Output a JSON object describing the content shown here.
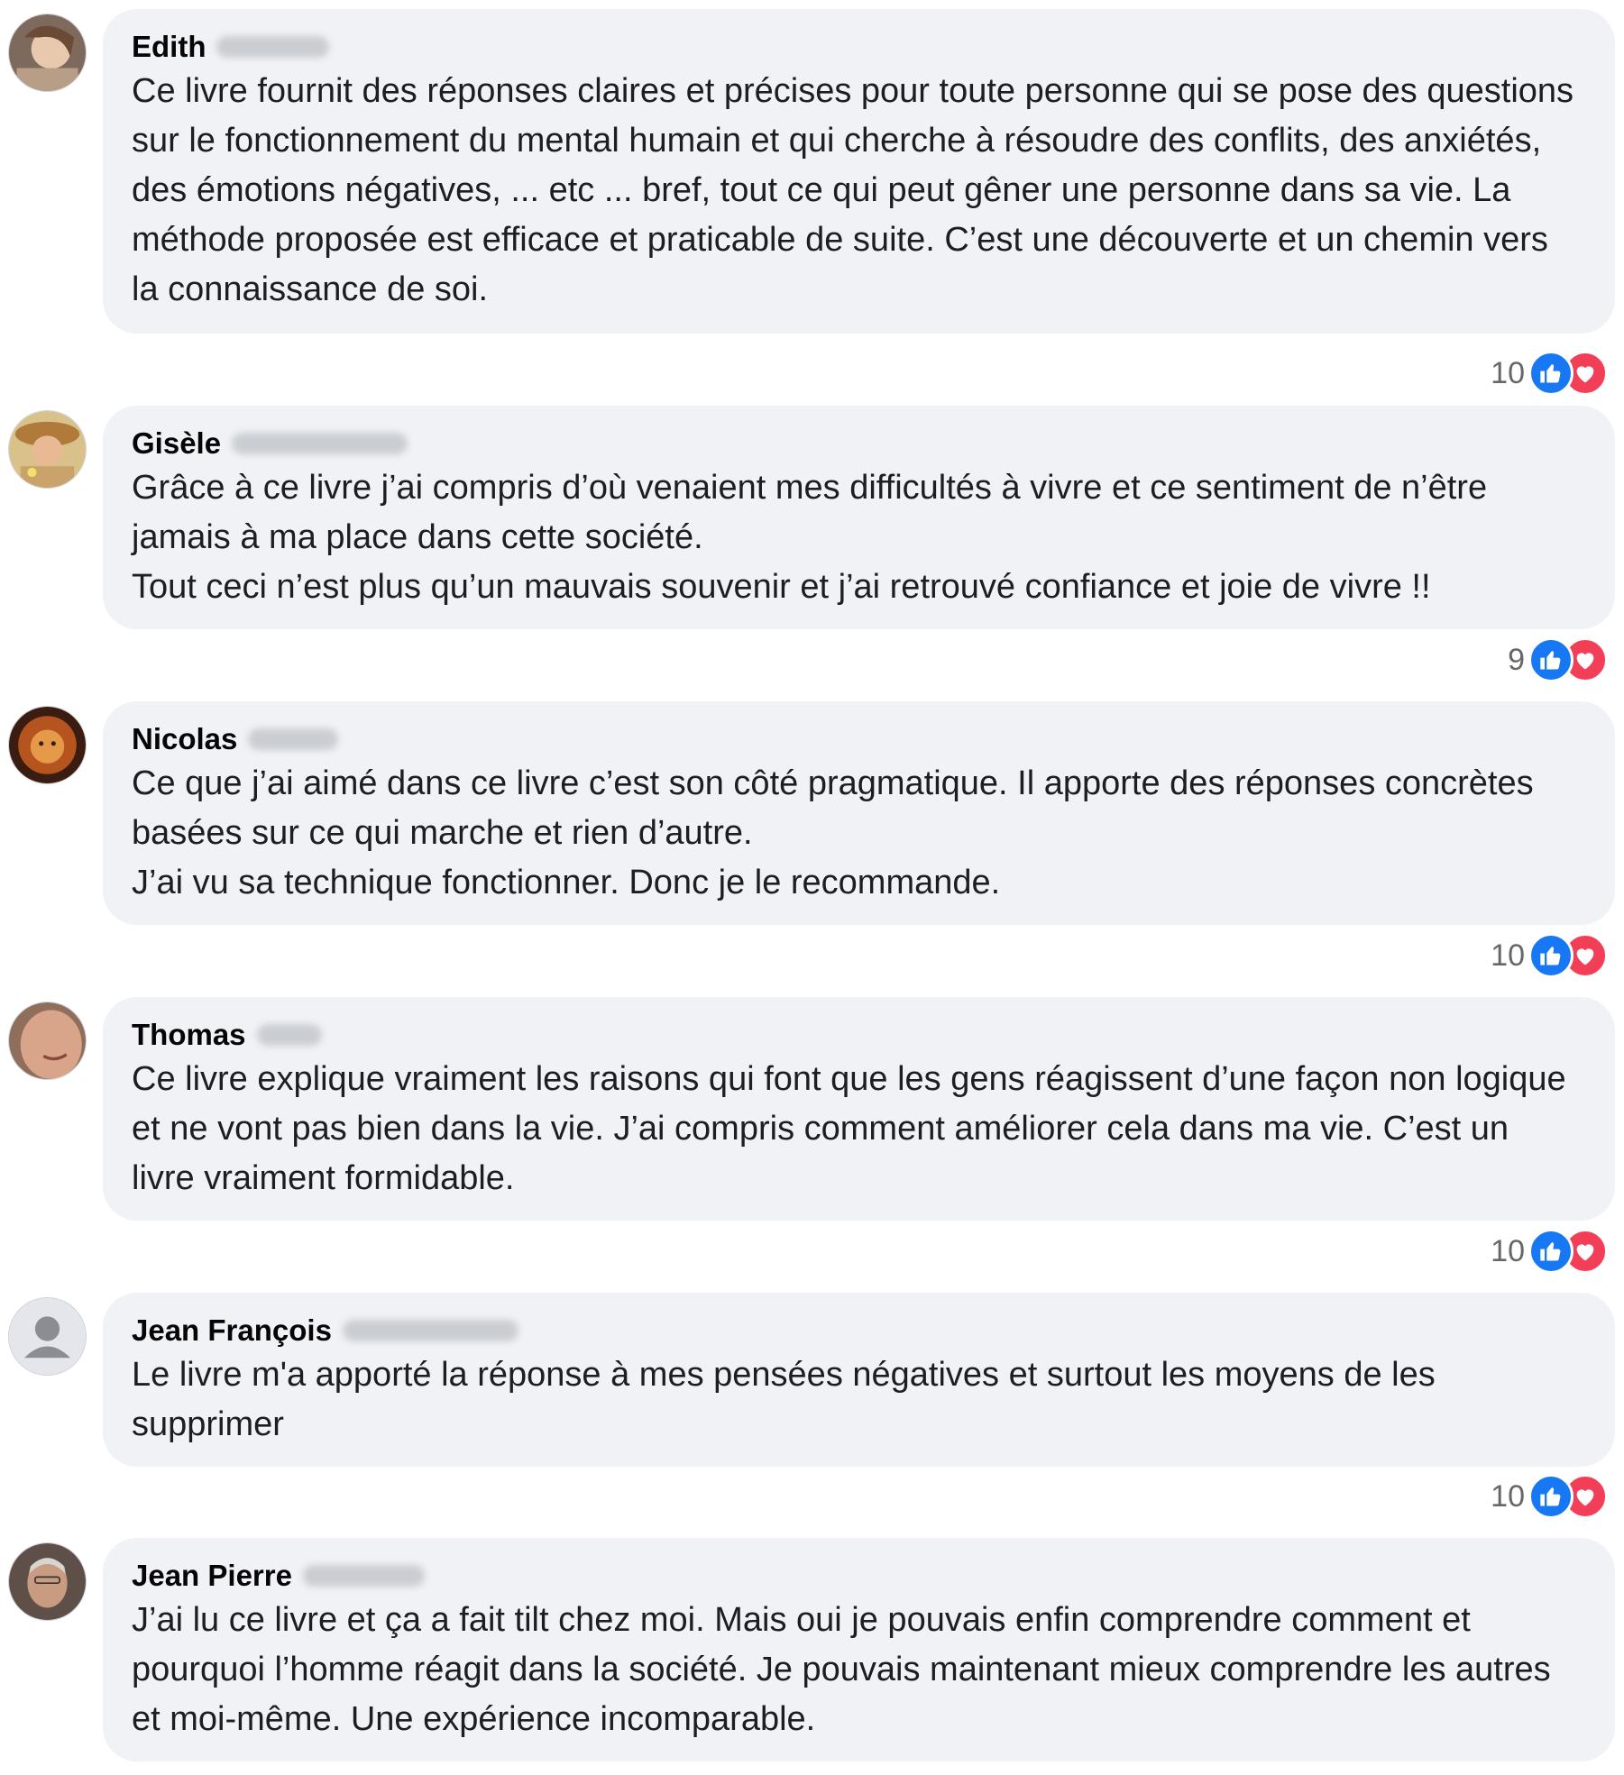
{
  "comments": [
    {
      "author": "Edith",
      "text": "Ce livre fournit des réponses claires et précises pour toute personne qui se pose des questions sur le fonctionnement du mental humain et qui cherche à résoudre des conflits, des anxiétés, des émotions négatives, ... etc ... bref, tout ce qui peut gêner une personne dans sa vie. La méthode proposée est efficace et praticable de suite. C’est une découverte et un chemin vers la connaissance de soi.",
      "reaction_count": "10",
      "reactions": [
        "like-icon",
        "love-icon"
      ]
    },
    {
      "author": "Gisèle",
      "text": "Grâce à ce livre j’ai compris d’où venaient mes difficultés à vivre et ce sentiment de n’être jamais à ma place dans cette société.\nTout ceci n’est plus qu’un mauvais souvenir et j’ai retrouvé confiance et joie de vivre !!",
      "reaction_count": "9",
      "reactions": [
        "like-icon",
        "love-icon"
      ]
    },
    {
      "author": "Nicolas",
      "text": "Ce que j’ai aimé dans ce livre c’est son côté pragmatique. Il apporte des réponses concrètes basées sur ce qui marche et rien d’autre.\nJ’ai vu sa technique fonctionner. Donc je le recommande.",
      "reaction_count": "10",
      "reactions": [
        "like-icon",
        "love-icon"
      ]
    },
    {
      "author": "Thomas",
      "text": "Ce livre explique vraiment les raisons qui font que les gens réagissent d’une façon non logique et ne vont pas bien dans la vie. J’ai compris comment améliorer cela dans ma vie. C’est un livre vraiment formidable.",
      "reaction_count": "10",
      "reactions": [
        "like-icon",
        "love-icon"
      ]
    },
    {
      "author": "Jean François",
      "text": "Le livre m'a apporté la réponse à mes pensées négatives et surtout les moyens de les supprimer",
      "reaction_count": "10",
      "reactions": [
        "like-icon",
        "love-icon"
      ]
    },
    {
      "author": "Jean Pierre",
      "text": "J’ai lu ce livre et ça a fait tilt chez moi. Mais oui je pouvais enfin comprendre comment et pourquoi l’homme réagit dans la société. Je pouvais maintenant mieux comprendre les autres et moi-même. Une expérience incomparable.",
      "reaction_count": null,
      "reactions": []
    }
  ],
  "colors": {
    "bubble": "#f0f2f5",
    "like": "#1877f2",
    "love": "#f33e58",
    "count": "#65676b"
  }
}
